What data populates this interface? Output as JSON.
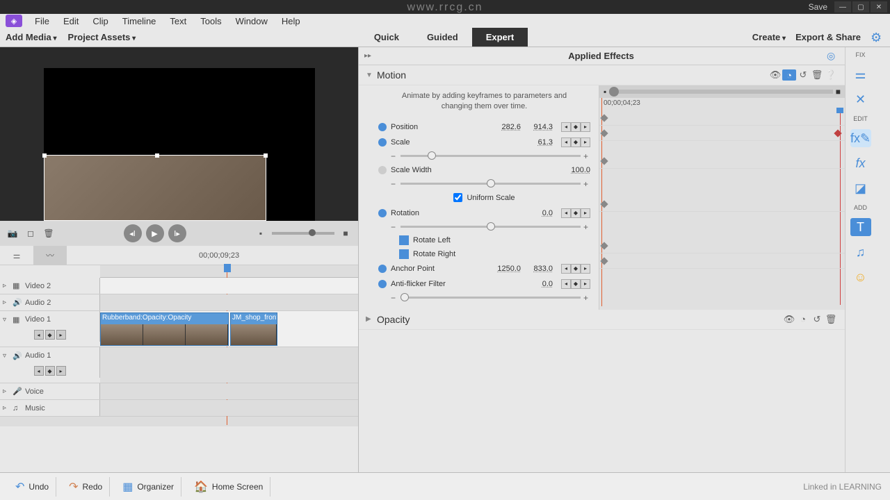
{
  "window": {
    "save": "Save"
  },
  "menu": [
    "File",
    "Edit",
    "Clip",
    "Timeline",
    "Text",
    "Tools",
    "Window",
    "Help"
  ],
  "modebar": {
    "add_media": "Add Media",
    "project_assets": "Project Assets",
    "tabs": {
      "quick": "Quick",
      "guided": "Guided",
      "expert": "Expert"
    },
    "create": "Create",
    "export": "Export & Share"
  },
  "transport": {
    "timecode": "00;00;09;23"
  },
  "tracks": {
    "video2": "Video 2",
    "audio2": "Audio 2",
    "video1": "Video 1",
    "audio1": "Audio 1",
    "voice": "Voice",
    "music": "Music",
    "clip1": "Rubberband:Opacity:Opacity",
    "clip2": "JM_shop_front.jpg"
  },
  "panel": {
    "title": "Applied Effects",
    "fix": "FIX",
    "edit": "EDIT",
    "add": "ADD"
  },
  "motion": {
    "name": "Motion",
    "hint": "Animate by adding keyframes to parameters and changing them over time.",
    "position": "Position",
    "position_x": "282.6",
    "position_y": "914.3",
    "scale": "Scale",
    "scale_v": "61.3",
    "scale_width": "Scale Width",
    "scale_width_v": "100.0",
    "uniform": "Uniform Scale",
    "rotation": "Rotation",
    "rotation_v": "0.0",
    "rotate_left": "Rotate Left",
    "rotate_right": "Rotate Right",
    "anchor": "Anchor Point",
    "anchor_x": "1250.0",
    "anchor_y": "833.0",
    "antiflicker": "Anti-flicker Filter",
    "antiflicker_v": "0.0",
    "kf_tc": "00;00;04;23"
  },
  "opacity": {
    "name": "Opacity"
  },
  "bottom": {
    "undo": "Undo",
    "redo": "Redo",
    "organizer": "Organizer",
    "home": "Home Screen",
    "brand": "Linked in LEARNING"
  },
  "watermark": "www.rrcg.cn"
}
